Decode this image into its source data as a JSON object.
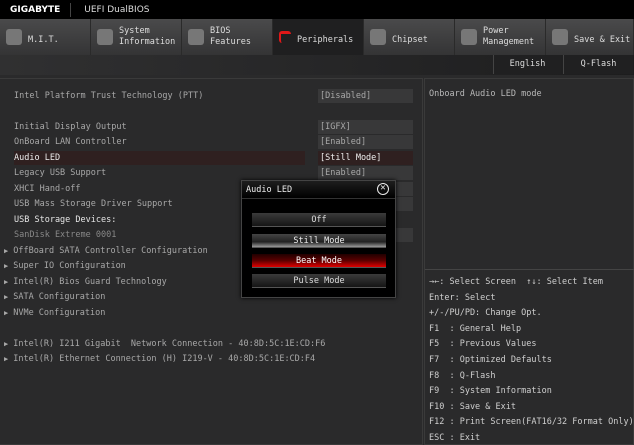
{
  "header": {
    "brand": "GIGABYTE",
    "title": "UEFI DualBIOS"
  },
  "tabs": [
    {
      "label": "M.I.T.",
      "icon": "disc-icon"
    },
    {
      "label": "System Information",
      "icon": "gear-icon"
    },
    {
      "label": "BIOS Features",
      "icon": "chip-plus-icon"
    },
    {
      "label": "Peripherals",
      "icon": "plug-icon",
      "active": true
    },
    {
      "label": "Chipset",
      "icon": "chipset-icon"
    },
    {
      "label": "Power Management",
      "icon": "power-icon"
    },
    {
      "label": "Save & Exit",
      "icon": "exit-icon"
    }
  ],
  "toolbar": {
    "language": "English",
    "qflash": "Q-Flash"
  },
  "settings": [
    {
      "label": "Intel Platform Trust Technology (PTT)",
      "value": "[Disabled]"
    },
    {
      "label": "Initial Display Output",
      "value": "[IGFX]"
    },
    {
      "label": "OnBoard LAN Controller",
      "value": "[Enabled]"
    },
    {
      "label": "Audio LED",
      "value": "[Still Mode]",
      "selected": true
    },
    {
      "label": "Legacy USB Support",
      "value": "[Enabled]"
    },
    {
      "label": "XHCI Hand-off"
    },
    {
      "label": "USB Mass Storage Driver Support"
    },
    {
      "label": "USB Storage Devices:"
    },
    {
      "label": "SanDisk Extreme 0001"
    }
  ],
  "submenus": [
    "OffBoard SATA Controller Configuration",
    "Super IO Configuration",
    "Intel(R) Bios Guard Technology",
    "SATA Configuration",
    "NVMe Configuration"
  ],
  "network": [
    "Intel(R) I211 Gigabit  Network Connection - 40:8D:5C:1E:CD:F6",
    "Intel(R) Ethernet Connection (H) I219-V - 40:8D:5C:1E:CD:F4"
  ],
  "help": {
    "description": "Onboard Audio LED mode",
    "keys": [
      "→←: Select Screen  ↑↓: Select Item",
      "Enter: Select",
      "+/-/PU/PD: Change Opt.",
      "F1  : General Help",
      "F5  : Previous Values",
      "F7  : Optimized Defaults",
      "F8  : Q-Flash",
      "F9  : System Information",
      "F10 : Save & Exit",
      "F12 : Print Screen(FAT16/32 Format Only)",
      "ESC : Exit"
    ]
  },
  "popup": {
    "title": "Audio LED",
    "options": [
      "Off",
      "Still Mode",
      "Beat Mode",
      "Pulse Mode"
    ],
    "current": "Still Mode",
    "highlighted": "Beat Mode"
  },
  "colors": {
    "accent": "#e01818",
    "background": "#2a2a2b"
  }
}
